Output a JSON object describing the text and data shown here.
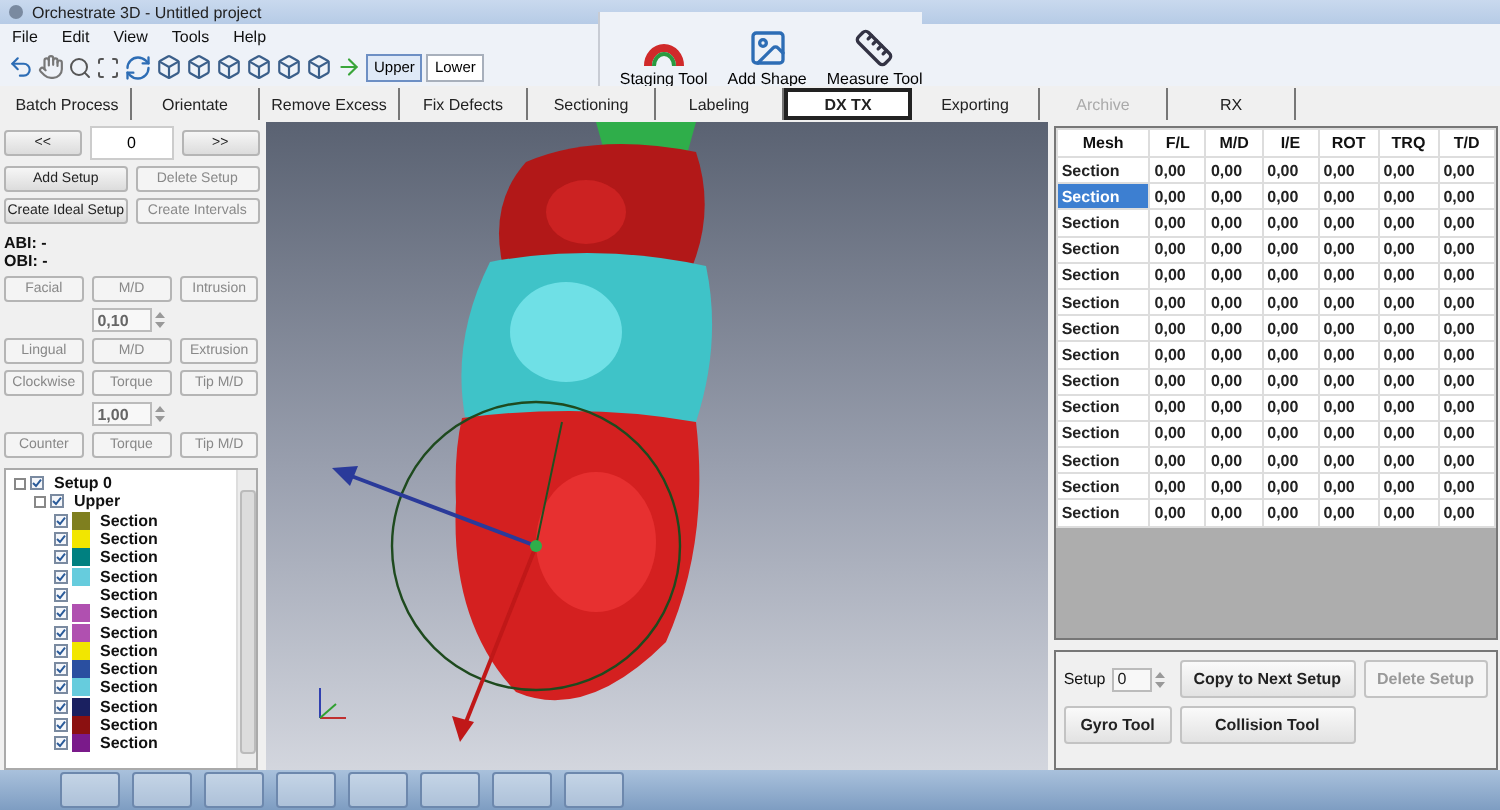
{
  "window": {
    "title": "Orchestrate 3D - Untitled project"
  },
  "menu": [
    "File",
    "Edit",
    "View",
    "Tools",
    "Help"
  ],
  "toolbar": {
    "jaw_toggle": [
      {
        "label": "Upper",
        "selected": true
      },
      {
        "label": "Lower",
        "selected": false
      }
    ],
    "tools": [
      {
        "label": "Staging Tool",
        "kind": "arch"
      },
      {
        "label": "Add Shape",
        "kind": "shape"
      },
      {
        "label": "Measure Tool",
        "kind": "measure"
      }
    ]
  },
  "tabs": [
    {
      "label": "Batch Process",
      "selected": false,
      "disabled": false
    },
    {
      "label": "Orientate",
      "selected": false,
      "disabled": false
    },
    {
      "label": "Remove Excess",
      "selected": false,
      "disabled": false
    },
    {
      "label": "Fix Defects",
      "selected": false,
      "disabled": false
    },
    {
      "label": "Sectioning",
      "selected": false,
      "disabled": false
    },
    {
      "label": "Labeling",
      "selected": false,
      "disabled": false
    },
    {
      "label": "DX TX",
      "selected": true,
      "disabled": false
    },
    {
      "label": "Exporting",
      "selected": false,
      "disabled": false
    },
    {
      "label": "Archive",
      "selected": false,
      "disabled": true
    },
    {
      "label": "RX",
      "selected": false,
      "disabled": false
    }
  ],
  "left_panel": {
    "nav": {
      "prev": "<<",
      "value": "0",
      "next": ">>"
    },
    "setup_buttons": [
      {
        "label": "Add Setup",
        "disabled": false
      },
      {
        "label": "Delete Setup",
        "disabled": true
      },
      {
        "label": "Create Ideal Setup",
        "disabled": false
      },
      {
        "label": "Create Intervals",
        "disabled": true
      }
    ],
    "indices": [
      "ABI: -",
      "OBI: -"
    ],
    "adjust_rows": [
      {
        "kind": "buttons",
        "buttons": [
          {
            "label": "Facial",
            "disabled": true
          },
          {
            "label": "M/D",
            "disabled": true
          },
          {
            "label": "Intrusion",
            "disabled": true
          }
        ]
      },
      {
        "kind": "spinner",
        "value": "0,10"
      },
      {
        "kind": "buttons",
        "buttons": [
          {
            "label": "Lingual",
            "disabled": true
          },
          {
            "label": "M/D",
            "disabled": true
          },
          {
            "label": "Extrusion",
            "disabled": true
          }
        ]
      },
      {
        "kind": "buttons",
        "buttons": [
          {
            "label": "Clockwise",
            "disabled": true
          },
          {
            "label": "Torque",
            "disabled": true
          },
          {
            "label": "Tip M/D",
            "disabled": true
          }
        ]
      },
      {
        "kind": "spinner",
        "value": "1,00"
      },
      {
        "kind": "buttons",
        "buttons": [
          {
            "label": "Counter",
            "disabled": true
          },
          {
            "label": "Torque",
            "disabled": true
          },
          {
            "label": "Tip M/D",
            "disabled": true
          }
        ]
      }
    ],
    "tree": [
      {
        "label": "Setup 0",
        "checked": true,
        "expanded": true,
        "children": [
          {
            "label": "Upper",
            "checked": true,
            "expanded": true,
            "children": [
              {
                "label": "Section",
                "checked": true,
                "color": "#7f7f1f"
              },
              {
                "label": "Section",
                "checked": true,
                "color": "#f2e600"
              },
              {
                "label": "Section",
                "checked": true,
                "color": "#008080"
              },
              {
                "label": "Section",
                "checked": true,
                "color": "#66ccdd"
              },
              {
                "label": "Section",
                "checked": true
              },
              {
                "label": "Section",
                "checked": true,
                "color": "#b050b0"
              },
              {
                "label": "Section",
                "checked": true,
                "color": "#b050b0"
              },
              {
                "label": "Section",
                "checked": true,
                "color": "#f2e600"
              },
              {
                "label": "Section",
                "checked": true,
                "color": "#2a4fa0"
              },
              {
                "label": "Section",
                "checked": true,
                "color": "#66ccdd"
              },
              {
                "label": "Section",
                "checked": true,
                "color": "#1a2060"
              },
              {
                "label": "Section",
                "checked": true,
                "color": "#8b1010"
              },
              {
                "label": "Section",
                "checked": true,
                "color": "#7a1a8a"
              }
            ]
          }
        ]
      }
    ]
  },
  "table": {
    "columns": [
      "Mesh",
      "F/L",
      "M/D",
      "I/E",
      "ROT",
      "TRQ",
      "T/D"
    ],
    "rows": [
      {
        "selected": false,
        "cells": [
          "Section",
          "0,00",
          "0,00",
          "0,00",
          "0,00",
          "0,00",
          "0,00"
        ]
      },
      {
        "selected": true,
        "cells": [
          "Section",
          "0,00",
          "0,00",
          "0,00",
          "0,00",
          "0,00",
          "0,00"
        ]
      },
      {
        "selected": false,
        "cells": [
          "Section",
          "0,00",
          "0,00",
          "0,00",
          "0,00",
          "0,00",
          "0,00"
        ]
      },
      {
        "selected": false,
        "cells": [
          "Section",
          "0,00",
          "0,00",
          "0,00",
          "0,00",
          "0,00",
          "0,00"
        ]
      },
      {
        "selected": false,
        "cells": [
          "Section",
          "0,00",
          "0,00",
          "0,00",
          "0,00",
          "0,00",
          "0,00"
        ]
      },
      {
        "selected": false,
        "cells": [
          "Section",
          "0,00",
          "0,00",
          "0,00",
          "0,00",
          "0,00",
          "0,00"
        ]
      },
      {
        "selected": false,
        "cells": [
          "Section",
          "0,00",
          "0,00",
          "0,00",
          "0,00",
          "0,00",
          "0,00"
        ]
      },
      {
        "selected": false,
        "cells": [
          "Section",
          "0,00",
          "0,00",
          "0,00",
          "0,00",
          "0,00",
          "0,00"
        ]
      },
      {
        "selected": false,
        "cells": [
          "Section",
          "0,00",
          "0,00",
          "0,00",
          "0,00",
          "0,00",
          "0,00"
        ]
      },
      {
        "selected": false,
        "cells": [
          "Section",
          "0,00",
          "0,00",
          "0,00",
          "0,00",
          "0,00",
          "0,00"
        ]
      },
      {
        "selected": false,
        "cells": [
          "Section",
          "0,00",
          "0,00",
          "0,00",
          "0,00",
          "0,00",
          "0,00"
        ]
      },
      {
        "selected": false,
        "cells": [
          "Section",
          "0,00",
          "0,00",
          "0,00",
          "0,00",
          "0,00",
          "0,00"
        ]
      },
      {
        "selected": false,
        "cells": [
          "Section",
          "0,00",
          "0,00",
          "0,00",
          "0,00",
          "0,00",
          "0,00"
        ]
      },
      {
        "selected": false,
        "cells": [
          "Section",
          "0,00",
          "0,00",
          "0,00",
          "0,00",
          "0,00",
          "0,00"
        ]
      }
    ]
  },
  "setup_controls": {
    "label": "Setup",
    "value": "0",
    "buttons": [
      {
        "label": "Copy to Next Setup",
        "disabled": false
      },
      {
        "label": "Delete Setup",
        "disabled": true
      },
      {
        "label": "Gyro Tool",
        "disabled": false
      },
      {
        "label": "Collision Tool",
        "disabled": false
      }
    ]
  }
}
